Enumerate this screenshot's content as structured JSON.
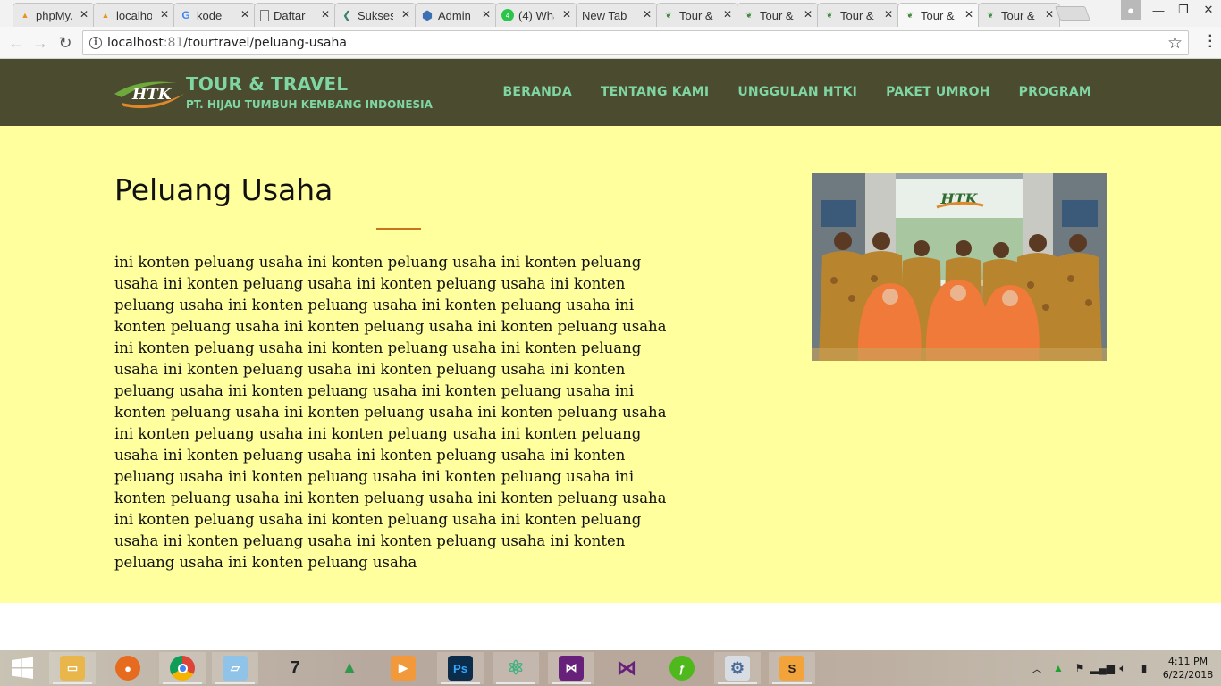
{
  "browser": {
    "tabs": [
      {
        "title": "phpMyAdmin",
        "favicon": "pma"
      },
      {
        "title": "localhost",
        "favicon": "pma"
      },
      {
        "title": "kode",
        "favicon": "google"
      },
      {
        "title": "Daftar",
        "favicon": "doc"
      },
      {
        "title": "Sukses",
        "favicon": "arrow"
      },
      {
        "title": "Admin",
        "favicon": "hex"
      },
      {
        "title": "(4) WhatsApp",
        "favicon": "wa"
      },
      {
        "title": "New Tab",
        "favicon": "none"
      },
      {
        "title": "Tour &",
        "favicon": "htk"
      },
      {
        "title": "Tour &",
        "favicon": "htk"
      },
      {
        "title": "Tour &",
        "favicon": "htk"
      },
      {
        "title": "Tour &",
        "favicon": "htk"
      },
      {
        "title": "Tour &",
        "favicon": "htk"
      }
    ],
    "url_host": "localhost",
    "url_port": ":81",
    "url_path": "/tourtravel/peluang-usaha"
  },
  "site": {
    "logo_text": "HTK",
    "brand_title": "TOUR & TRAVEL",
    "brand_subtitle": "PT. HIJAU TUMBUH KEMBANG INDONESIA",
    "menu": [
      "BERANDA",
      "TENTANG KAMI",
      "UNGGULAN HTKI",
      "PAKET UMROH",
      "PROGRAM"
    ]
  },
  "page": {
    "title": "Peluang Usaha",
    "body": "ini konten peluang usaha ini konten peluang usaha ini konten peluang usaha ini konten peluang usaha ini konten peluang usaha ini konten peluang usaha ini konten peluang usaha ini konten peluang usaha ini konten peluang usaha ini konten peluang usaha ini konten peluang usaha ini konten peluang usaha ini konten peluang usaha ini konten peluang usaha ini konten peluang usaha ini konten peluang usaha ini konten peluang usaha ini konten peluang usaha ini konten peluang usaha ini konten peluang usaha ini konten peluang usaha ini konten peluang usaha ini konten peluang usaha ini konten peluang usaha ini konten peluang usaha ini konten peluang usaha ini konten peluang usaha ini konten peluang usaha ini konten peluang usaha ini konten peluang usaha ini konten peluang usaha ini konten peluang usaha ini konten peluang usaha ini konten peluang usaha ini konten peluang usaha ini konten peluang usaha ini konten peluang usaha ini konten peluang usaha ini konten peluang usaha ini konten peluang usaha",
    "photo_sign_text": "HTK"
  },
  "taskbar": {
    "apps": [
      "file-explorer",
      "firefox",
      "chrome",
      "notepad",
      "app-7zip",
      "rocket",
      "media-player",
      "photoshop",
      "atom",
      "visual-studio",
      "visual-studio-2",
      "dreamweaver",
      "settings",
      "sublime"
    ],
    "time": "4:11 PM",
    "date": "6/22/2018"
  },
  "colors": {
    "nav_bg": "#4b4b2f",
    "nav_text": "#7fd6a3",
    "content_bg": "#ffff9e",
    "accent_underline": "#c8741b"
  }
}
